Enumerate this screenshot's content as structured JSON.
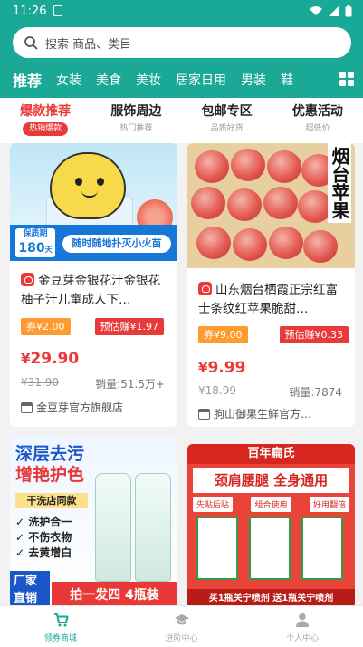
{
  "status": {
    "time": "11:26"
  },
  "search": {
    "placeholder": "搜索 商品、类目"
  },
  "categories": [
    "推荐",
    "女装",
    "美食",
    "美妆",
    "居家日用",
    "男装",
    "鞋"
  ],
  "subtabs": [
    {
      "title": "爆款推荐",
      "sub": "热销爆款"
    },
    {
      "title": "服饰周边",
      "sub": "热门推荐"
    },
    {
      "title": "包邮专区",
      "sub": "品质好货"
    },
    {
      "title": "优惠活动",
      "sub": "超低价"
    }
  ],
  "products": [
    {
      "image_badge_top": "保质期",
      "image_badge_num": "180",
      "image_badge_unit": "天",
      "image_promo": "随时随地扑灭小火苗",
      "title": "金豆芽金银花汁金银花柚子汁儿童成人下…",
      "coupon": "券¥2.00",
      "earn": "预估赚¥1.97",
      "price_symbol": "¥",
      "price": "29.90",
      "original_price": "¥31.90",
      "sales": "销量:51.5万+",
      "shop": "金豆芽官方旗舰店"
    },
    {
      "image_vertical_text": "烟台苹果",
      "title": "山东烟台栖霞正宗红富士条纹红苹果脆甜…",
      "coupon": "券¥9.00",
      "earn": "预估赚¥0.33",
      "price_symbol": "¥",
      "price": "9.99",
      "original_price": "¥18.99",
      "sales": "销量:7874",
      "shop": "朐山御果生鲜官方…"
    },
    {
      "image_headline_1": "深层去污",
      "image_headline_2": "增艳护色",
      "image_tag": "干洗店同款",
      "image_features": [
        "洗护合一",
        "不伤衣物",
        "去黄增白"
      ],
      "image_bottom_left": "厂家直销",
      "image_bottom_banner": "拍一发四 4瓶装"
    },
    {
      "image_brand": "百年扁氏",
      "image_headline": "颈肩腰腿 全身通用",
      "image_tags": [
        "先贴后贴",
        "组合使用",
        "好用翻倍"
      ],
      "image_bottom_banner": "买1瓶关宁喷剂 送1瓶关宁喷剂"
    }
  ],
  "tabbar": [
    {
      "label": "领券商城",
      "icon": "cart-icon"
    },
    {
      "label": "进阶中心",
      "icon": "graduation-cap-icon"
    },
    {
      "label": "个人中心",
      "icon": "user-icon"
    }
  ],
  "colors": {
    "primary": "#1aa897",
    "accent_red": "#e93a3a",
    "coupon_orange": "#ff9a2e"
  }
}
